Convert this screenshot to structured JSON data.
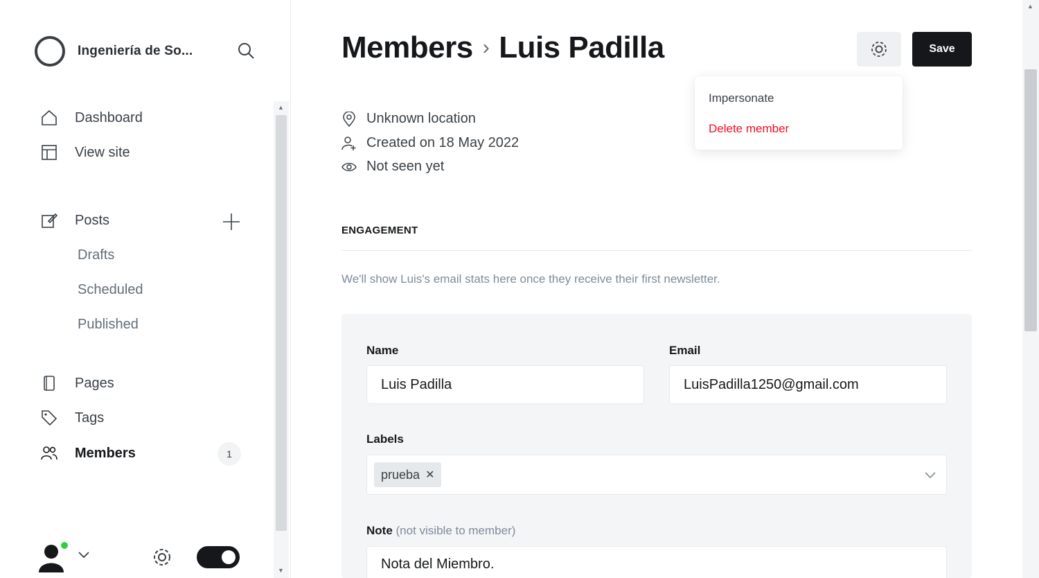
{
  "sidebar": {
    "brand_name": "Ingeniería de So...",
    "nav": {
      "dashboard": "Dashboard",
      "view_site": "View site",
      "posts": "Posts",
      "drafts": "Drafts",
      "scheduled": "Scheduled",
      "published": "Published",
      "pages": "Pages",
      "tags": "Tags",
      "members": "Members",
      "members_count": "1"
    }
  },
  "header": {
    "crumb_parent": "Members",
    "crumb_sep": "›",
    "crumb_current": "Luis Padilla",
    "save_label": "Save"
  },
  "dropdown": {
    "impersonate": "Impersonate",
    "delete": "Delete member"
  },
  "member_meta": {
    "location": "Unknown location",
    "created": "Created on 18 May 2022",
    "seen": "Not seen yet"
  },
  "engagement": {
    "heading": "ENGAGEMENT",
    "text": "We'll show Luis's email stats here once they receive their first newsletter."
  },
  "form": {
    "name_label": "Name",
    "name_value": "Luis Padilla",
    "email_label": "Email",
    "email_value": "LuisPadilla1250@gmail.com",
    "labels_label": "Labels",
    "labels": [
      "prueba"
    ],
    "note_label": "Note",
    "note_hint": "(not visible to member)",
    "note_value": "Nota del Miembro."
  },
  "colors": {
    "accent_dark": "#15171a",
    "danger": "#f50b23",
    "online": "#30cf43"
  }
}
